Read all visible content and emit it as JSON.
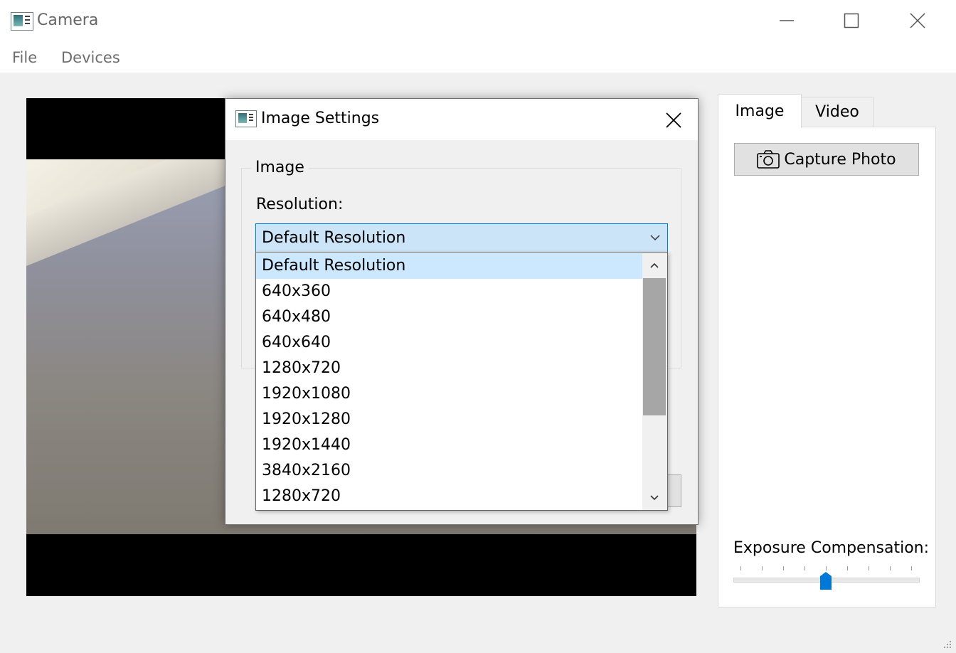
{
  "window": {
    "title": "Camera",
    "icon": "camera-app-icon",
    "controls": [
      "minimize-icon",
      "maximize-icon",
      "close-icon"
    ]
  },
  "menu": {
    "items": [
      {
        "label": "File"
      },
      {
        "label": "Devices"
      }
    ]
  },
  "tabs": [
    {
      "label": "Image",
      "selected": true
    },
    {
      "label": "Video",
      "selected": false
    }
  ],
  "image_tab": {
    "capture_label": "Capture Photo",
    "capture_icon": "camera-icon",
    "exposure_label": "Exposure Compensation:",
    "exposure_ticks": 9,
    "exposure_value_fraction": 0.5
  },
  "dialog": {
    "title": "Image Settings",
    "group_title": "Image",
    "resolution_label": "Resolution:",
    "resolution_value": "Default Resolution",
    "resolution_options": [
      "Default Resolution",
      "640x360",
      "640x480",
      "640x640",
      "1280x720",
      "1920x1080",
      "1920x1280",
      "1920x1440",
      "3840x2160",
      "1280x720"
    ],
    "selected_option_index": 0
  },
  "colors": {
    "accent": "#0078d7",
    "selection": "#cce8ff",
    "combo_background": "#cce4f7"
  }
}
